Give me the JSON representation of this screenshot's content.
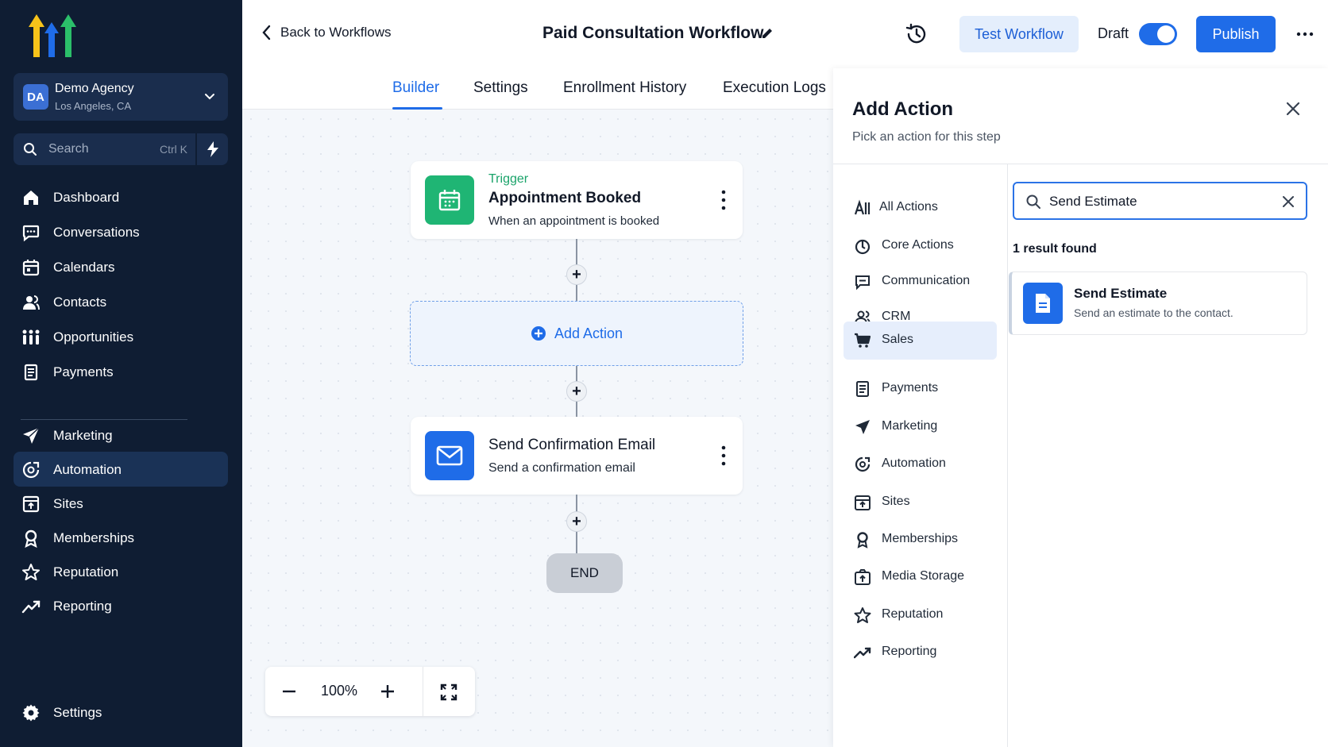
{
  "agency": {
    "initials": "DA",
    "name": "Demo Agency",
    "location": "Los Angeles, CA"
  },
  "sidebar": {
    "search_label": "Search",
    "search_shortcut": "Ctrl K",
    "items": [
      {
        "label": "Dashboard",
        "icon": "home-icon"
      },
      {
        "label": "Conversations",
        "icon": "chat-icon"
      },
      {
        "label": "Calendars",
        "icon": "calendar-icon"
      },
      {
        "label": "Contacts",
        "icon": "contacts-icon"
      },
      {
        "label": "Opportunities",
        "icon": "opportunities-icon"
      },
      {
        "label": "Payments",
        "icon": "payments-icon"
      },
      {
        "label": "Marketing",
        "icon": "send-icon"
      },
      {
        "label": "Automation",
        "icon": "automation-icon"
      },
      {
        "label": "Sites",
        "icon": "sites-icon"
      },
      {
        "label": "Memberships",
        "icon": "award-icon"
      },
      {
        "label": "Reputation",
        "icon": "star-icon"
      },
      {
        "label": "Reporting",
        "icon": "chart-icon"
      }
    ],
    "active_item": "Automation",
    "settings_label": "Settings"
  },
  "header": {
    "back_label": "Back to Workflows",
    "title": "Paid Consultation Workflow",
    "test_label": "Test Workflow",
    "draft_label": "Draft",
    "draft_toggle_on": true,
    "publish_label": "Publish"
  },
  "tabs": [
    {
      "label": "Builder",
      "active": true
    },
    {
      "label": "Settings",
      "active": false
    },
    {
      "label": "Enrollment History",
      "active": false
    },
    {
      "label": "Execution Logs",
      "active": false
    }
  ],
  "canvas": {
    "trigger": {
      "tag": "Trigger",
      "title": "Appointment Booked",
      "subtitle": "When an appointment is booked"
    },
    "add_action_label": "Add Action",
    "action": {
      "title": "Send Confirmation Email",
      "subtitle": "Send a confirmation email"
    },
    "end_label": "END",
    "zoom_level": "100%"
  },
  "panel": {
    "title": "Add Action",
    "subtitle": "Pick an action for this step",
    "categories": [
      {
        "label": "All Actions",
        "icon": "all-actions-icon"
      },
      {
        "label": "Core Actions",
        "icon": "core-actions-icon"
      },
      {
        "label": "Communication",
        "icon": "chat-icon"
      },
      {
        "label": "CRM",
        "icon": "contacts-icon"
      },
      {
        "label": "Sales",
        "icon": "cart-icon"
      },
      {
        "label": "Payments",
        "icon": "payments-icon"
      },
      {
        "label": "Marketing",
        "icon": "send-icon"
      },
      {
        "label": "Automation",
        "icon": "automation-icon"
      },
      {
        "label": "Sites",
        "icon": "sites-icon"
      },
      {
        "label": "Memberships",
        "icon": "award-icon"
      },
      {
        "label": "Media Storage",
        "icon": "media-icon"
      },
      {
        "label": "Reputation",
        "icon": "star-icon"
      },
      {
        "label": "Reporting",
        "icon": "chart-icon"
      }
    ],
    "active_category": "Sales",
    "search_value": "Send Estimate",
    "result_count": "1 result found",
    "results": [
      {
        "title": "Send Estimate",
        "description": "Send an estimate to the contact."
      }
    ]
  },
  "colors": {
    "sidebar_bg": "#0f1d33",
    "accent": "#1f6ce8",
    "trigger_green": "#1fb574",
    "canvas_bg": "#f4f7fb"
  }
}
